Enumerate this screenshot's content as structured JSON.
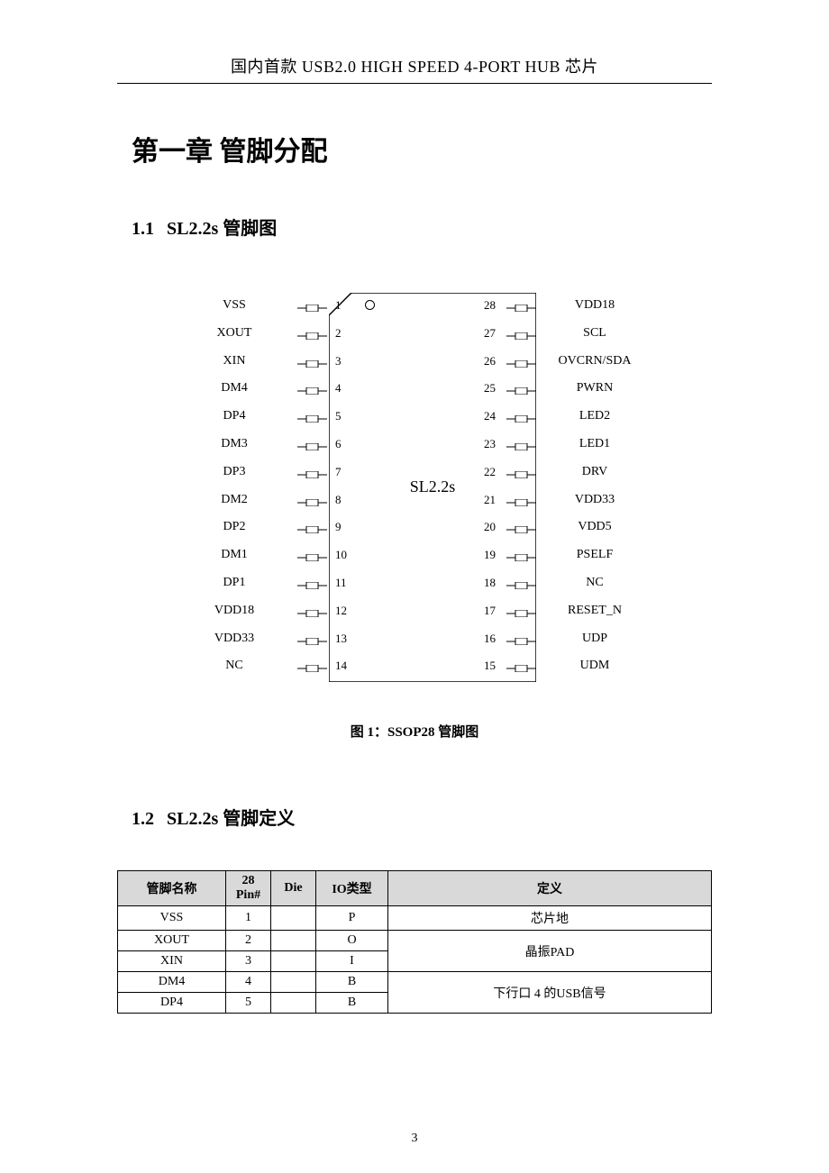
{
  "header": "国内首款 USB2.0 HIGH SPEED 4-PORT HUB 芯片",
  "chapter_title": "第一章  管脚分配",
  "section1": {
    "num": "1.1",
    "title": "SL2.2s 管脚图"
  },
  "chip": {
    "label": "SL2.2s",
    "left_pins": [
      {
        "num": "1",
        "name": "VSS"
      },
      {
        "num": "2",
        "name": "XOUT"
      },
      {
        "num": "3",
        "name": "XIN"
      },
      {
        "num": "4",
        "name": "DM4"
      },
      {
        "num": "5",
        "name": "DP4"
      },
      {
        "num": "6",
        "name": "DM3"
      },
      {
        "num": "7",
        "name": "DP3"
      },
      {
        "num": "8",
        "name": "DM2"
      },
      {
        "num": "9",
        "name": "DP2"
      },
      {
        "num": "10",
        "name": "DM1"
      },
      {
        "num": "11",
        "name": "DP1"
      },
      {
        "num": "12",
        "name": "VDD18"
      },
      {
        "num": "13",
        "name": "VDD33"
      },
      {
        "num": "14",
        "name": "NC"
      }
    ],
    "right_pins": [
      {
        "num": "28",
        "name": "VDD18"
      },
      {
        "num": "27",
        "name": "SCL"
      },
      {
        "num": "26",
        "name": "OVCRN/SDA"
      },
      {
        "num": "25",
        "name": "PWRN"
      },
      {
        "num": "24",
        "name": "LED2"
      },
      {
        "num": "23",
        "name": "LED1"
      },
      {
        "num": "22",
        "name": "DRV"
      },
      {
        "num": "21",
        "name": "VDD33"
      },
      {
        "num": "20",
        "name": "VDD5"
      },
      {
        "num": "19",
        "name": "PSELF"
      },
      {
        "num": "18",
        "name": "NC"
      },
      {
        "num": "17",
        "name": "RESET_N"
      },
      {
        "num": "16",
        "name": "UDP"
      },
      {
        "num": "15",
        "name": "UDM"
      }
    ]
  },
  "fig_caption": "图 1：SSOP28 管脚图",
  "section2": {
    "num": "1.2",
    "title": "SL2.2s 管脚定义"
  },
  "table": {
    "headers": {
      "name": "管脚名称",
      "pin": "28 Pin#",
      "die": "Die",
      "io": "IO类型",
      "def": "定义"
    },
    "rows": [
      {
        "name": "VSS",
        "pin": "1",
        "die": "",
        "io": "P",
        "def": "芯片地",
        "rowspan_def": 1
      },
      {
        "name": "XOUT",
        "pin": "2",
        "die": "",
        "io": "O",
        "def": "晶振PAD",
        "rowspan_def": 2
      },
      {
        "name": "XIN",
        "pin": "3",
        "die": "",
        "io": "I"
      },
      {
        "name": "DM4",
        "pin": "4",
        "die": "",
        "io": "B",
        "def": "下行口 4 的USB信号",
        "rowspan_def": 2
      },
      {
        "name": "DP4",
        "pin": "5",
        "die": "",
        "io": "B"
      }
    ]
  },
  "page_number": "3"
}
